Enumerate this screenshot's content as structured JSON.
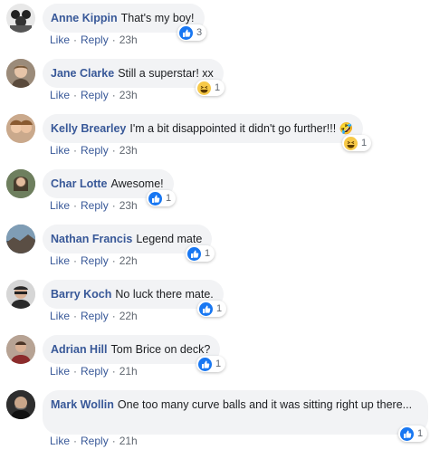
{
  "comments": [
    {
      "name": "Anne Kippin",
      "text": "That's my boy!",
      "reply": "Reply",
      "like": "Like",
      "time": "23h",
      "reaction_icon": "like-icon",
      "reaction_count": "3"
    },
    {
      "name": "Jane Clarke",
      "text": "Still a superstar! xx",
      "reply": "Reply",
      "like": "Like",
      "time": "23h",
      "reaction_icon": "haha-icon",
      "reaction_count": "1"
    },
    {
      "name": "Kelly Brearley",
      "text": "I'm a bit disappointed it didn't go further!!! 🤣",
      "reply": "Reply",
      "like": "Like",
      "time": "23h",
      "reaction_icon": "haha-icon",
      "reaction_count": "1"
    },
    {
      "name": "Char Lotte",
      "text": "Awesome!",
      "reply": "Reply",
      "like": "Like",
      "time": "23h",
      "reaction_icon": "like-icon",
      "reaction_count": "1"
    },
    {
      "name": "Nathan Francis",
      "text": "Legend mate",
      "reply": "Reply",
      "like": "Like",
      "time": "22h",
      "reaction_icon": "like-icon",
      "reaction_count": "1"
    },
    {
      "name": "Barry Koch",
      "text": "No luck there mate.",
      "reply": "Reply",
      "like": "Like",
      "time": "22h",
      "reaction_icon": "like-icon",
      "reaction_count": "1"
    },
    {
      "name": "Adrian Hill",
      "text": "Tom Brice on deck?",
      "reply": "Reply",
      "like": "Like",
      "time": "21h",
      "reaction_icon": "like-icon",
      "reaction_count": "1"
    },
    {
      "name": "Mark Wollin",
      "text": "One too many curve balls and it was sitting right up there...",
      "reply": "Reply",
      "like": "Like",
      "time": "21h",
      "reaction_icon": "like-icon",
      "reaction_count": "1"
    }
  ],
  "colors": {
    "name_link": "#385898",
    "bubble_bg": "#f2f3f5",
    "like_blue": "#1877f2",
    "haha_yellow": "#f7c948"
  }
}
